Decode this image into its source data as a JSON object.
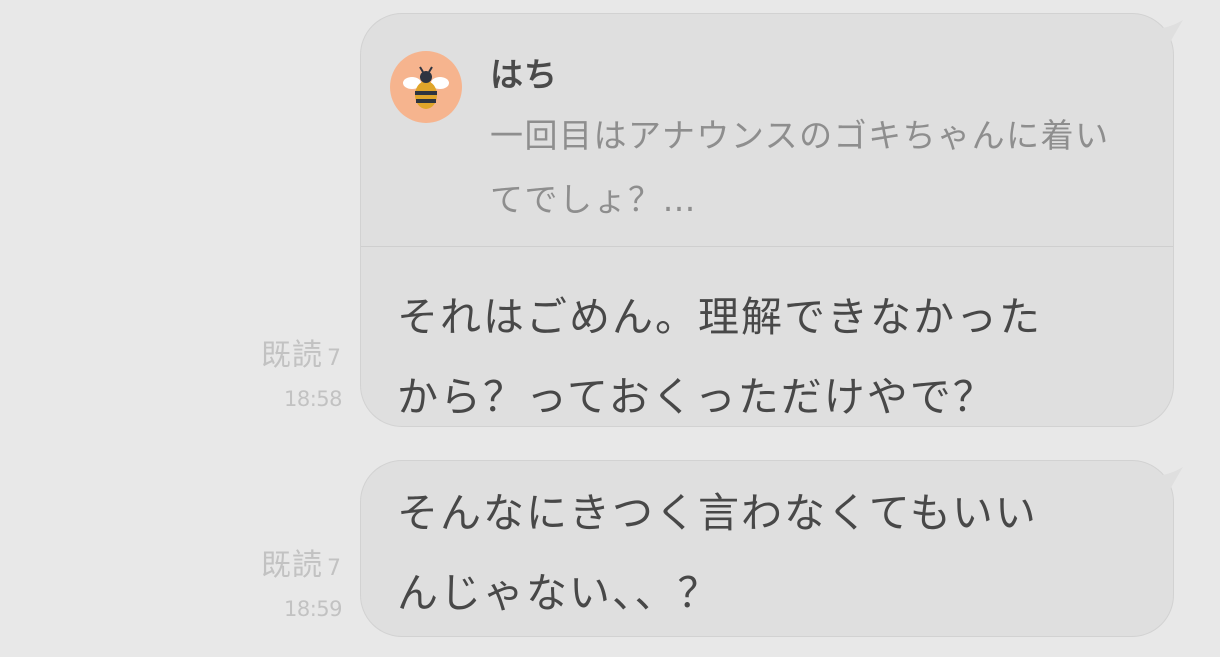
{
  "messages": [
    {
      "read_label": "既読",
      "read_count": "7",
      "time": "18:58",
      "reply": {
        "name": "はち",
        "avatar_icon": "bee-icon",
        "text": "一回目はアナウンスのゴキちゃんに着いてでしょ？…"
      },
      "text_lines": [
        "それはごめん。理解できなかった",
        "から？っておくっただけやで？"
      ]
    },
    {
      "read_label": "既読",
      "read_count": "7",
      "time": "18:59",
      "text_lines": [
        "そんなにきつく言わなくてもいい",
        "んじゃない、、？"
      ]
    }
  ],
  "colors": {
    "background": "#e8e8e8",
    "bubble": "#dfdfdf",
    "avatar": "#f6b48e"
  }
}
